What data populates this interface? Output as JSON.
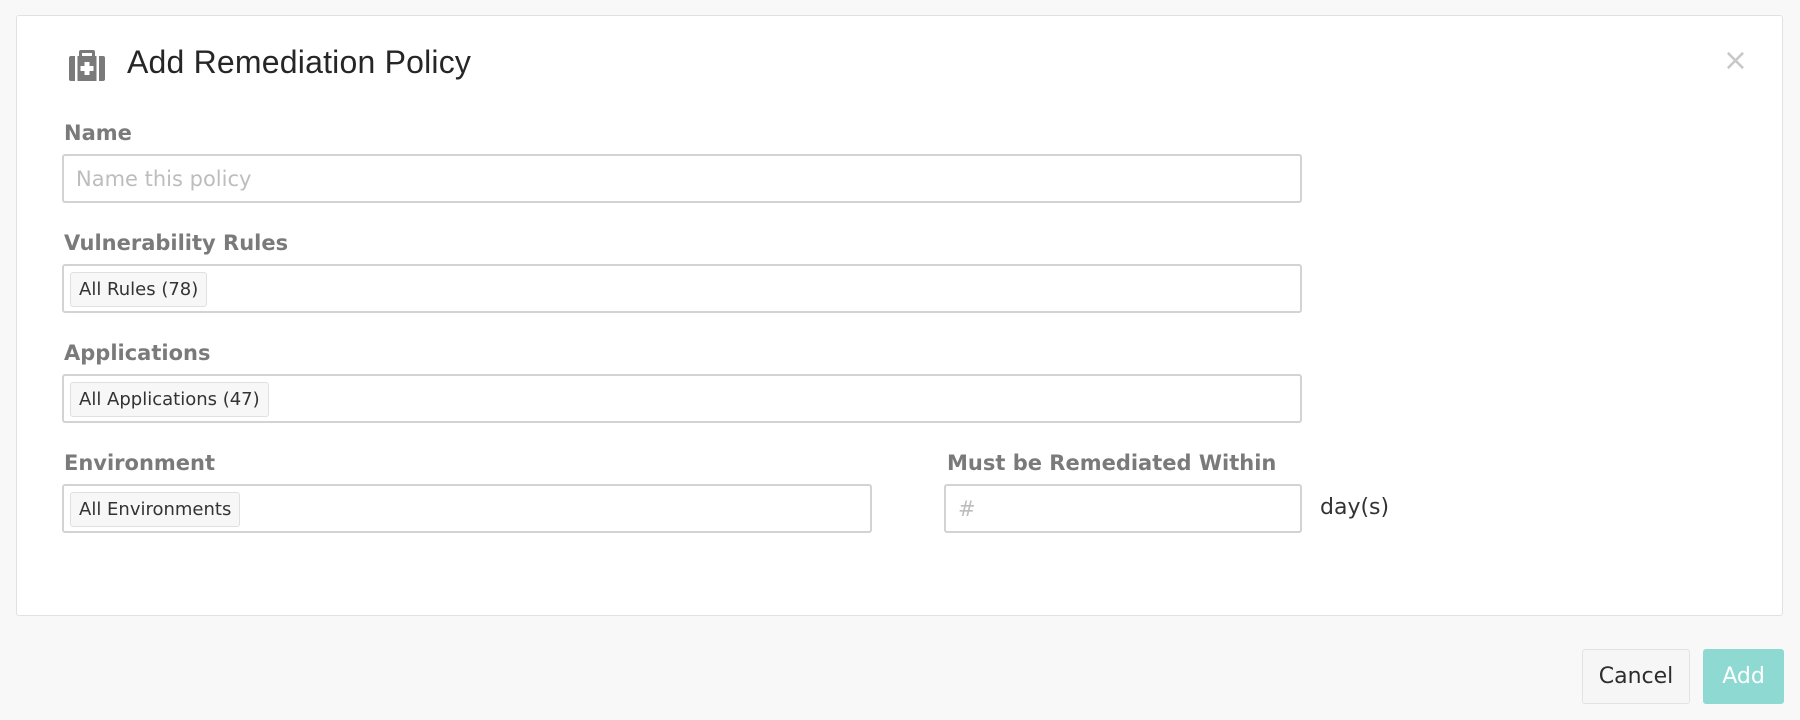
{
  "dialog": {
    "title": "Add Remediation Policy",
    "icon": "first-aid-kit-icon",
    "close_label": "×"
  },
  "fields": {
    "name": {
      "label": "Name",
      "value": "",
      "placeholder": "Name this policy"
    },
    "vulnerability_rules": {
      "label": "Vulnerability Rules",
      "chip": "All Rules (78)"
    },
    "applications": {
      "label": "Applications",
      "chip": "All Applications (47)"
    },
    "environment": {
      "label": "Environment",
      "chip": "All Environments"
    },
    "remediate_within": {
      "label": "Must be Remediated Within",
      "value": "",
      "placeholder": "#",
      "unit": "day(s)"
    }
  },
  "footer": {
    "cancel_label": "Cancel",
    "add_label": "Add"
  },
  "colors": {
    "add_button": "#8ed9d2",
    "label": "#7a7a7a",
    "border": "#d3d3d3",
    "background": "#f8f8f8"
  }
}
